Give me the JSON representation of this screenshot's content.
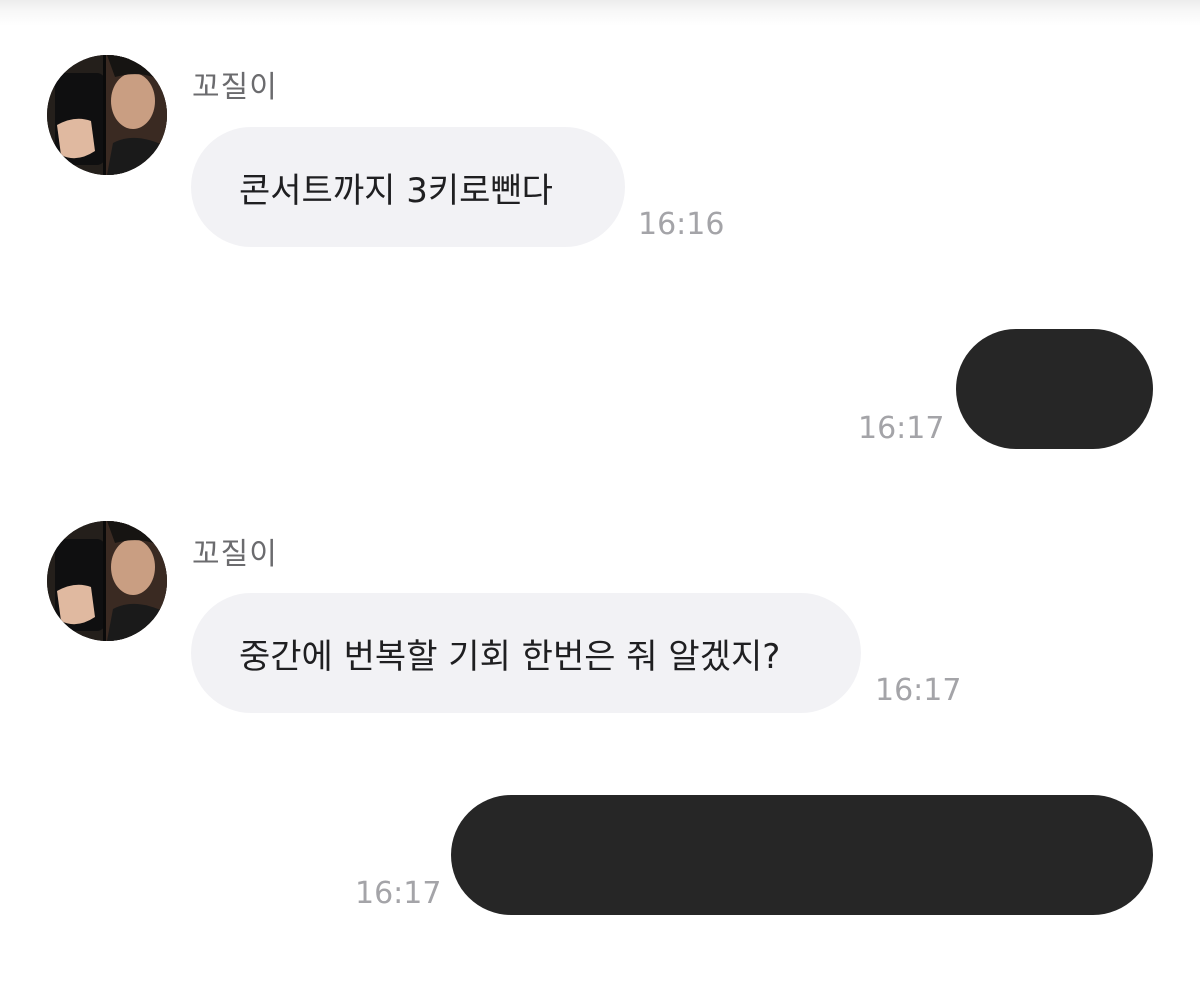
{
  "conversation": {
    "messages": [
      {
        "direction": "incoming",
        "sender": "꼬질이",
        "text": "콘서트까지 3키로뺀다",
        "time": "16:16"
      },
      {
        "direction": "outgoing",
        "text": "",
        "time": "16:17",
        "redacted": true
      },
      {
        "direction": "incoming",
        "sender": "꼬질이",
        "text": "중간에 번복할 기회 한번은 줘 알겠지?",
        "time": "16:17"
      },
      {
        "direction": "outgoing",
        "text": "",
        "time": "16:17",
        "redacted": true
      }
    ]
  },
  "colors": {
    "incoming_bubble": "#f2f2f5",
    "outgoing_bubble": "#262626",
    "sender_name": "#6b6b6e",
    "timestamp": "#a4a4a8",
    "message_text": "#1f1f21",
    "background": "#ffffff"
  }
}
